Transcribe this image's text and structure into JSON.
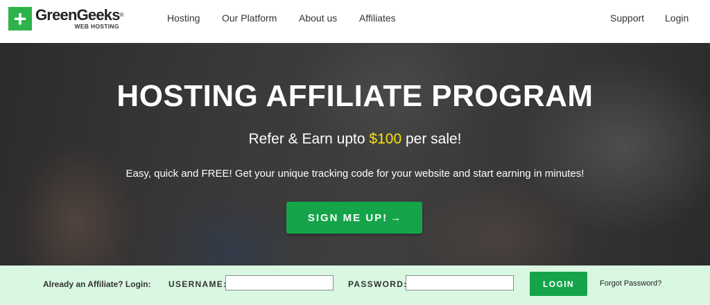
{
  "header": {
    "logo_mark": "+",
    "logo_name": "GreenGeeks",
    "logo_reg": "®",
    "logo_sub": "WEB HOSTING",
    "nav": [
      "Hosting",
      "Our Platform",
      "About us",
      "Affiliates"
    ],
    "support": "Support",
    "login": "Login"
  },
  "hero": {
    "title": "HOSTING AFFILIATE PROGRAM",
    "sub_before": "Refer & Earn upto ",
    "sub_amount": "$100",
    "sub_after": " per sale!",
    "description": "Easy, quick and FREE! Get your unique tracking code for your website and start earning in minutes!",
    "cta": "SIGN ME UP!",
    "cta_arrow": "→"
  },
  "login_bar": {
    "prompt": "Already an Affiliate? Login:",
    "username_label": "USERNAME:",
    "username_value": "",
    "password_label": "PASSWORD:",
    "password_value": "",
    "button": "LOGIN",
    "forgot": "Forgot Password?"
  },
  "colors": {
    "brand_green": "#15a44a",
    "logo_green": "#2db34a",
    "highlight_yellow": "#f6e20a",
    "login_bar_bg": "#d9f7e1"
  }
}
